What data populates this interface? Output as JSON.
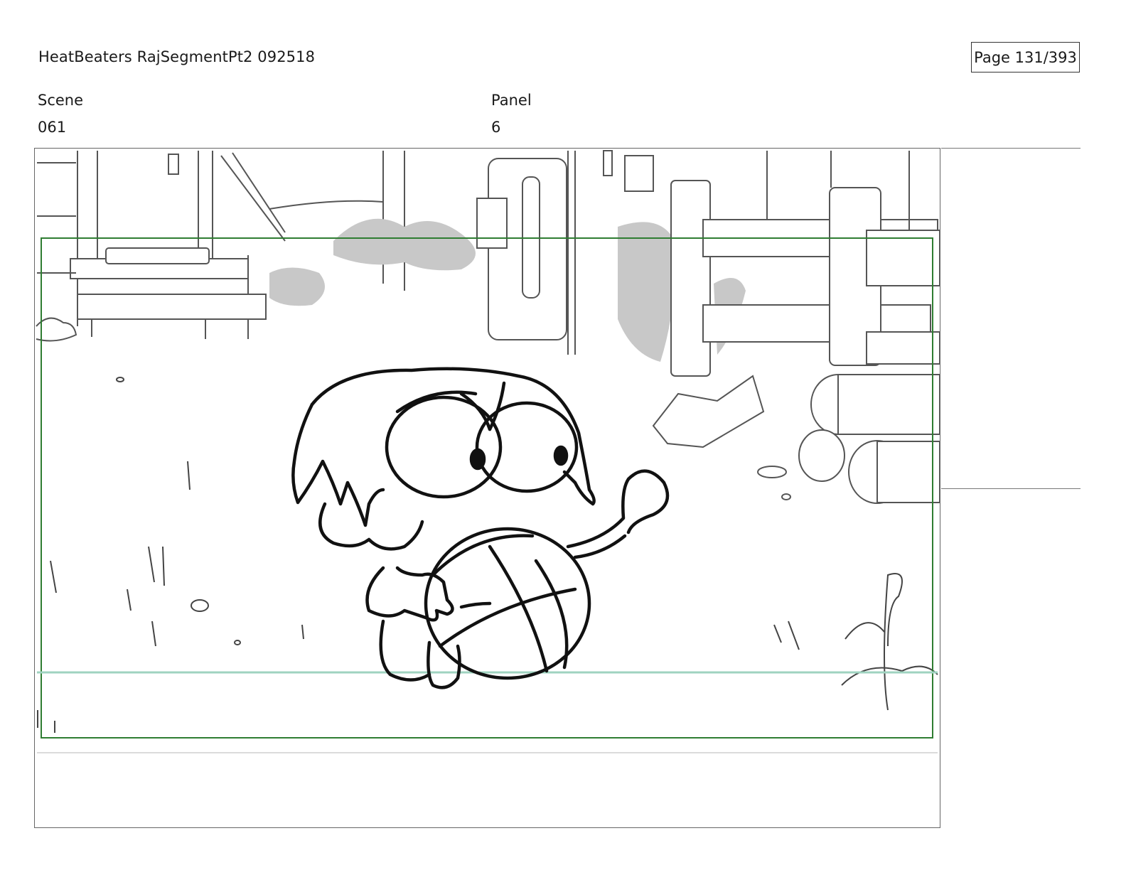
{
  "header": {
    "title": "HeatBeaters RajSegmentPt2 092518",
    "page": "Page 131/393"
  },
  "fields": {
    "scene_label": "Scene",
    "scene_value": "061",
    "panel_label": "Panel",
    "panel_value": "6"
  },
  "colors": {
    "safe_frame": "#2f7d32",
    "horizon_line": "#9fd3c0",
    "bush_fill": "#c8c8c8"
  },
  "icons": {
    "storyboard_panel": "kid-with-ball-drawing"
  }
}
